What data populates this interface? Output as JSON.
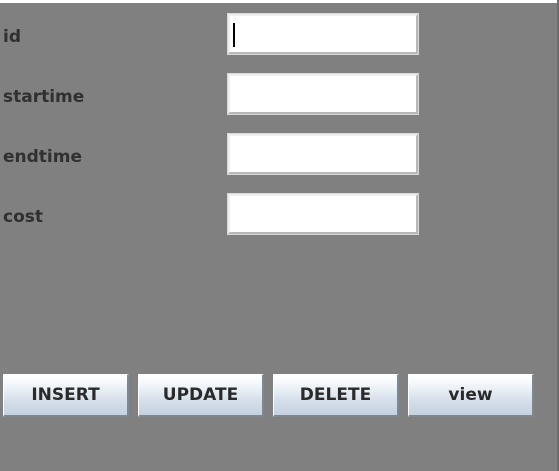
{
  "form": {
    "fields": [
      {
        "label": "id",
        "value": ""
      },
      {
        "label": "startime",
        "value": ""
      },
      {
        "label": "endtime",
        "value": ""
      },
      {
        "label": "cost",
        "value": ""
      }
    ]
  },
  "buttons": {
    "insert": "INSERT",
    "update": "UPDATE",
    "delete": "DELETE",
    "view": "view"
  }
}
